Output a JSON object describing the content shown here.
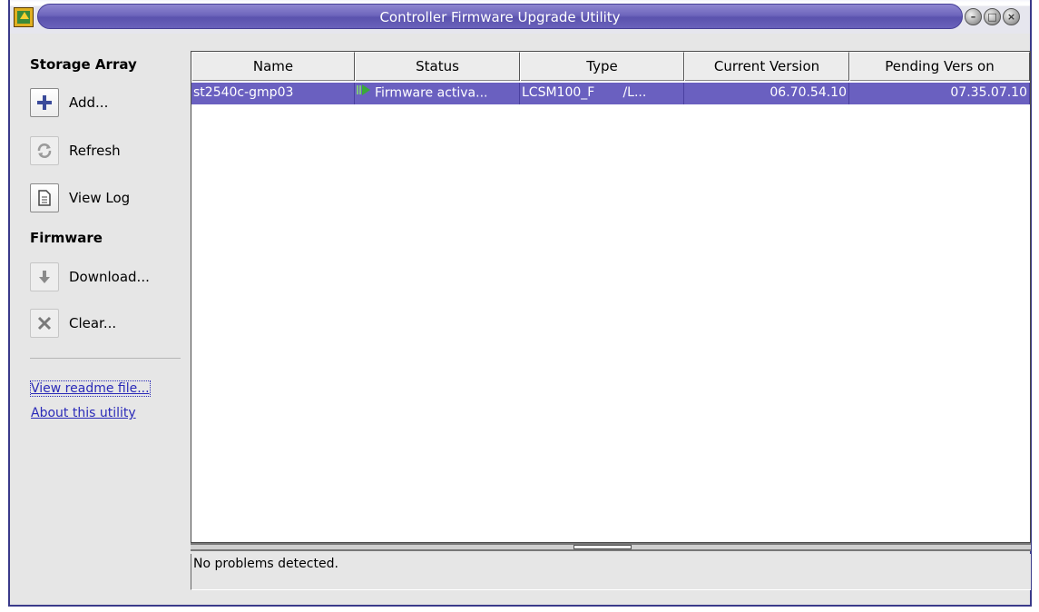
{
  "window": {
    "title": "Controller Firmware Upgrade Utility"
  },
  "sidebar": {
    "storage_array_title": "Storage Array",
    "firmware_title": "Firmware",
    "buttons": {
      "add": "Add...",
      "refresh": "Refresh",
      "view_log": "View Log",
      "download": "Download...",
      "clear": "Clear..."
    },
    "links": {
      "readme": "View readme file...",
      "about": "About this utility"
    }
  },
  "table": {
    "columns": [
      "Name",
      "Status",
      "Type",
      "Current Version",
      "Pending Vers on"
    ],
    "rows": [
      {
        "name": "st2540c-gmp03",
        "status": "Firmware activa...",
        "type": "LCSM100_F       /L...",
        "current_version": "06.70.54.10",
        "pending_version": "07.35.07.10",
        "selected": true
      }
    ]
  },
  "status_message": "No problems detected.",
  "icons": {
    "add": "plus-icon",
    "refresh": "refresh-icon",
    "view_log": "document-icon",
    "download": "download-arrow-icon",
    "clear": "x-icon",
    "status": "play-status-icon"
  },
  "colors": {
    "title_bar": "#6e66bd",
    "selection": "#6a60c0",
    "link": "#2a2ab8"
  }
}
